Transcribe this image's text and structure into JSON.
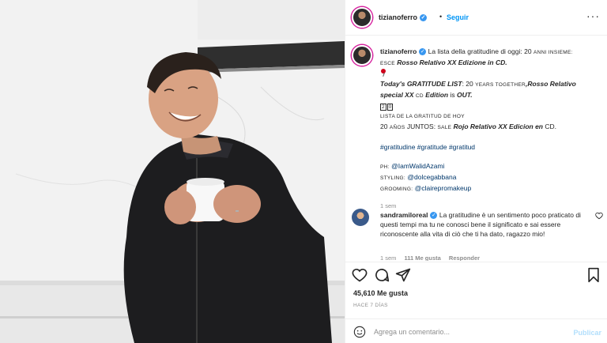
{
  "post": {
    "username": "tizianoferro",
    "verified_mark": "✓",
    "separator": "•",
    "follow_label": "Seguir",
    "more_label": "···"
  },
  "caption": {
    "username": "tizianoferro",
    "line1_text": "La lista della gratitudine di oggi: 20",
    "line1_sc": "ANNI INSIEME:",
    "line2_sc": "ESCE",
    "line2_bi": "Rosso Relativo XX Edizione in CD.",
    "en_title": "Today's GRATITUDE LIST",
    "en_colon": ": 20",
    "en_sc": "YEARS TOGETHER",
    "en_bold1": ",Rosso Relativo",
    "en_bold2": "special XX",
    "en_cd": "CD",
    "en_edition": "Edition",
    "en_is": "is",
    "en_out": "OUT.",
    "box1": "2",
    "box2": "0",
    "es_line1": "LISTA DE LA GRATITUD DE HOY",
    "es_line2_pre": "20",
    "es_line2_sc": "AÑOS",
    "es_line2_mid": "JUNTOS:",
    "es_line2_sale": "SALE",
    "es_line2_bi": "Rojo Relativo XX Edicion en",
    "es_line2_end": "CD.",
    "hashtags": "#gratitudine #gratitude #gratitud",
    "credit_ph_label": "PH:",
    "credit_ph": "@IamWalidAzami",
    "credit_styling_label": "STYLING:",
    "credit_styling": "@dolcegabbana",
    "credit_grooming_label": "GROOMING:",
    "credit_grooming": "@clairepromakeup",
    "time": "1 sem"
  },
  "comment": {
    "username": "sandramiloreal",
    "verified_mark": "✓",
    "text": "La gratitudine è un sentimento poco praticato di questi tempi ma tu ne conosci bene il significato e sai essere riconoscente alla vita di ciò che ti ha dato, ragazzo mio!",
    "time": "1 sem",
    "likes": "111 Me gusta",
    "reply": "Responder"
  },
  "likes": "45,610 Me gusta",
  "timeago": "HACE 7 DÍAS",
  "add_comment": {
    "placeholder": "Agrega un comentario...",
    "post_label": "Publicar"
  },
  "icons": [
    "heart-icon",
    "comment-icon",
    "share-icon",
    "bookmark-icon",
    "emoji-icon",
    "more-options-icon"
  ],
  "colors": {
    "link": "#00376b",
    "accent": "#0095f6",
    "verified": "#3897f0",
    "muted": "#8e8e8e"
  }
}
